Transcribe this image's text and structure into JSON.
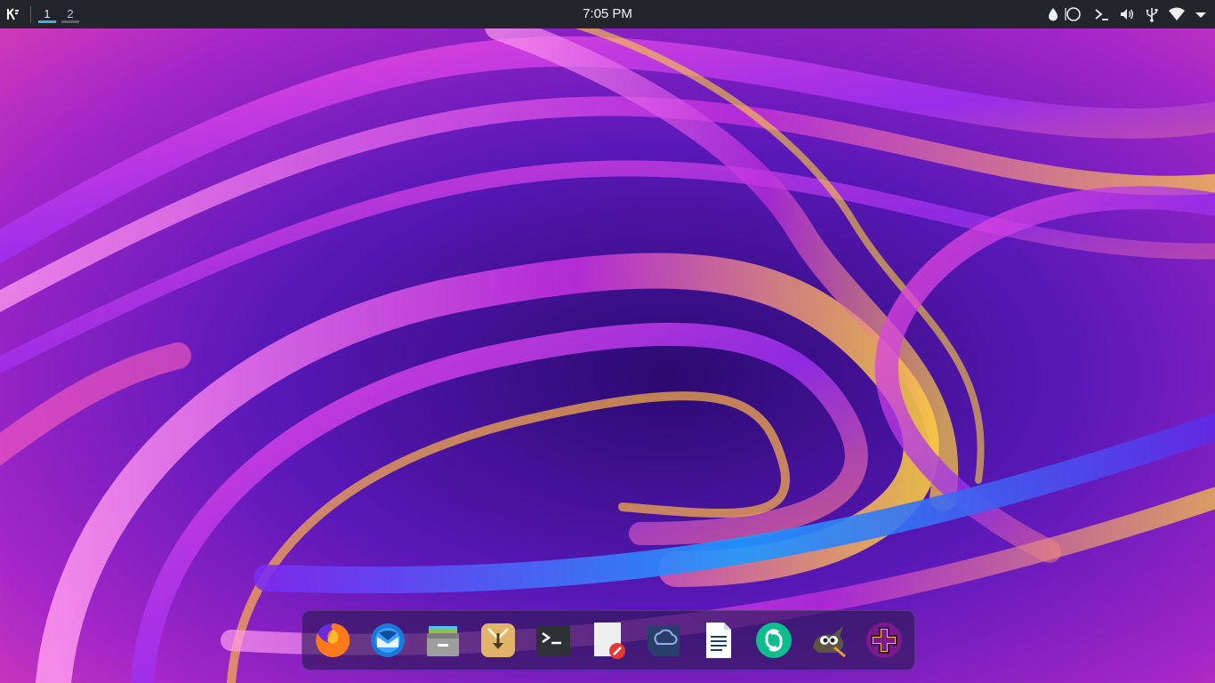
{
  "panel": {
    "launcher_icon": "kde-icon",
    "pager": [
      {
        "label": "1",
        "active": true
      },
      {
        "label": "2",
        "active": false
      }
    ],
    "clock": "7:05 PM",
    "tray_icons": [
      "color-picker-icon",
      "screen-icon",
      "terminal-console-icon",
      "volume-icon",
      "usb-device-icon",
      "wifi-icon",
      "chevron-down-icon"
    ]
  },
  "dock": {
    "apps": [
      "firefox",
      "thunderbird",
      "archive-manager",
      "downloader",
      "terminal",
      "text-editor",
      "cloud-sync",
      "document-viewer",
      "element-messenger",
      "gimp",
      "health-app"
    ]
  },
  "colors": {
    "panel_bg": "#24252b",
    "accent": "#3daee9",
    "wallpaper_base": "#3a0f86"
  }
}
